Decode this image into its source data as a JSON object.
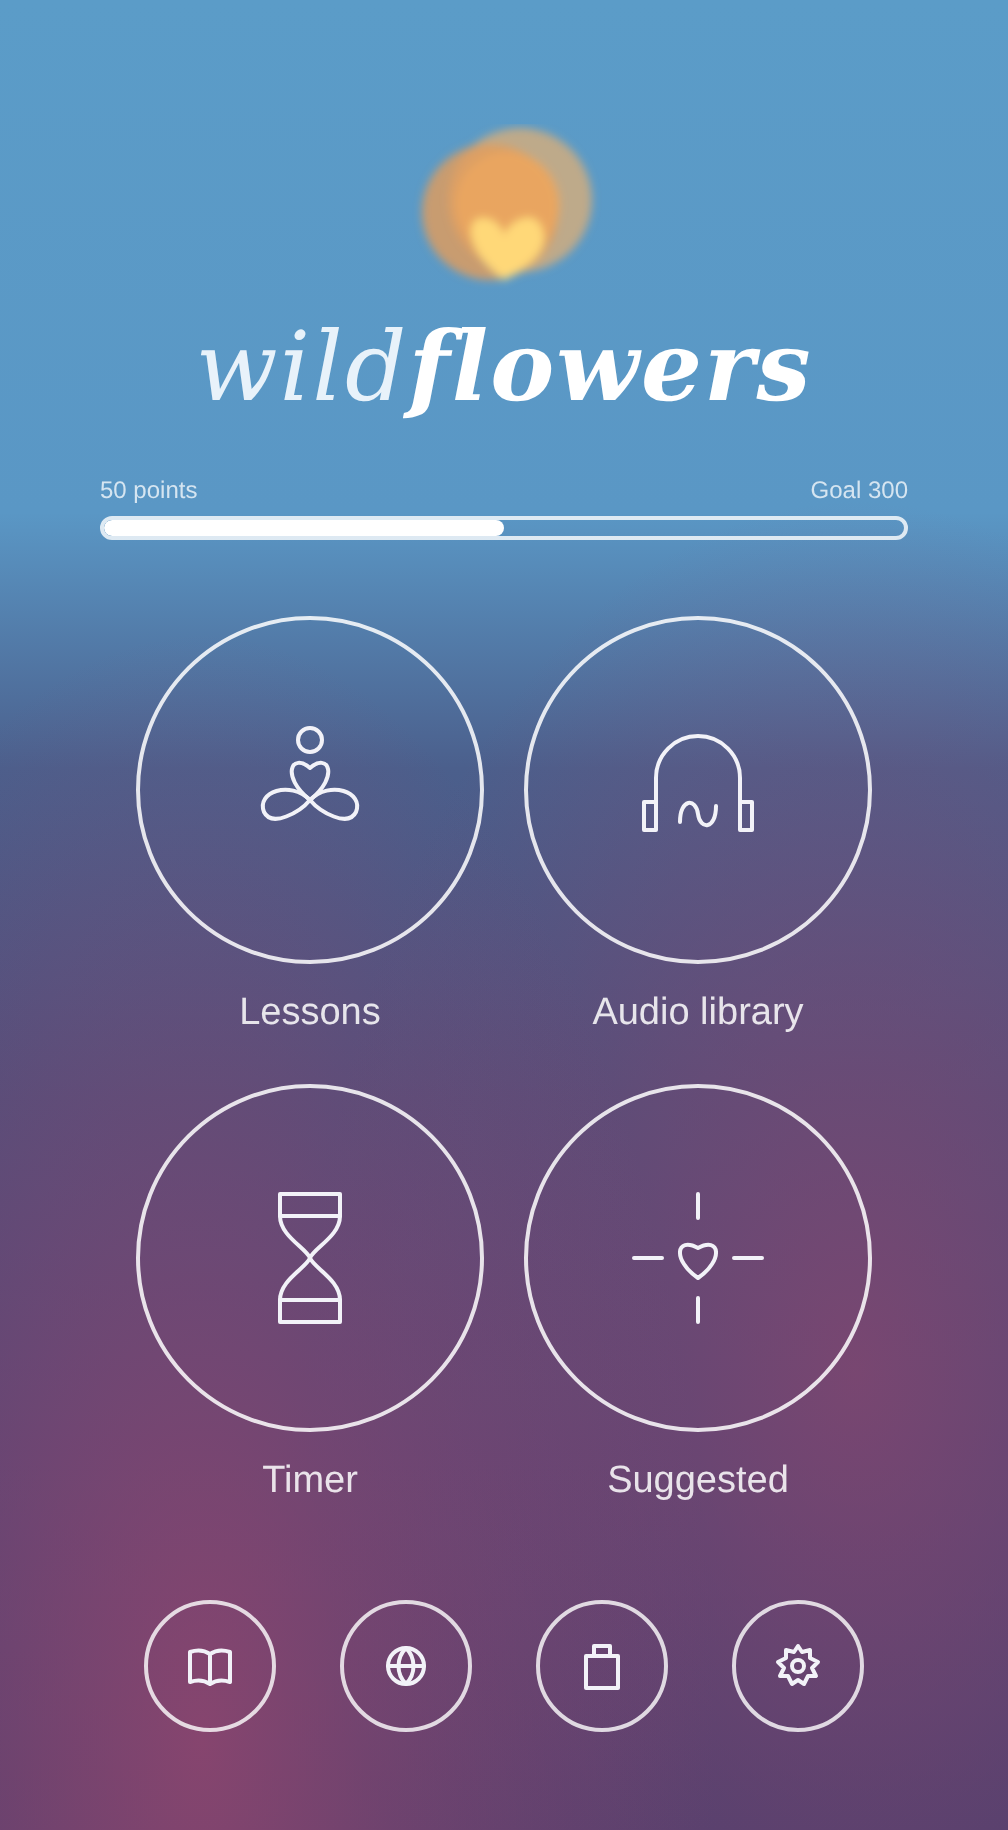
{
  "logo": {
    "wordmark": "wild**flowers**"
  },
  "progress": {
    "points": "50 points",
    "goal": "Goal 300",
    "level": 0.5
  },
  "tiles": [
    {
      "label": "Lessons"
    },
    {
      "label": "Audio library"
    },
    {
      "label": "Timer"
    },
    {
      "label": "Suggested"
    }
  ]
}
